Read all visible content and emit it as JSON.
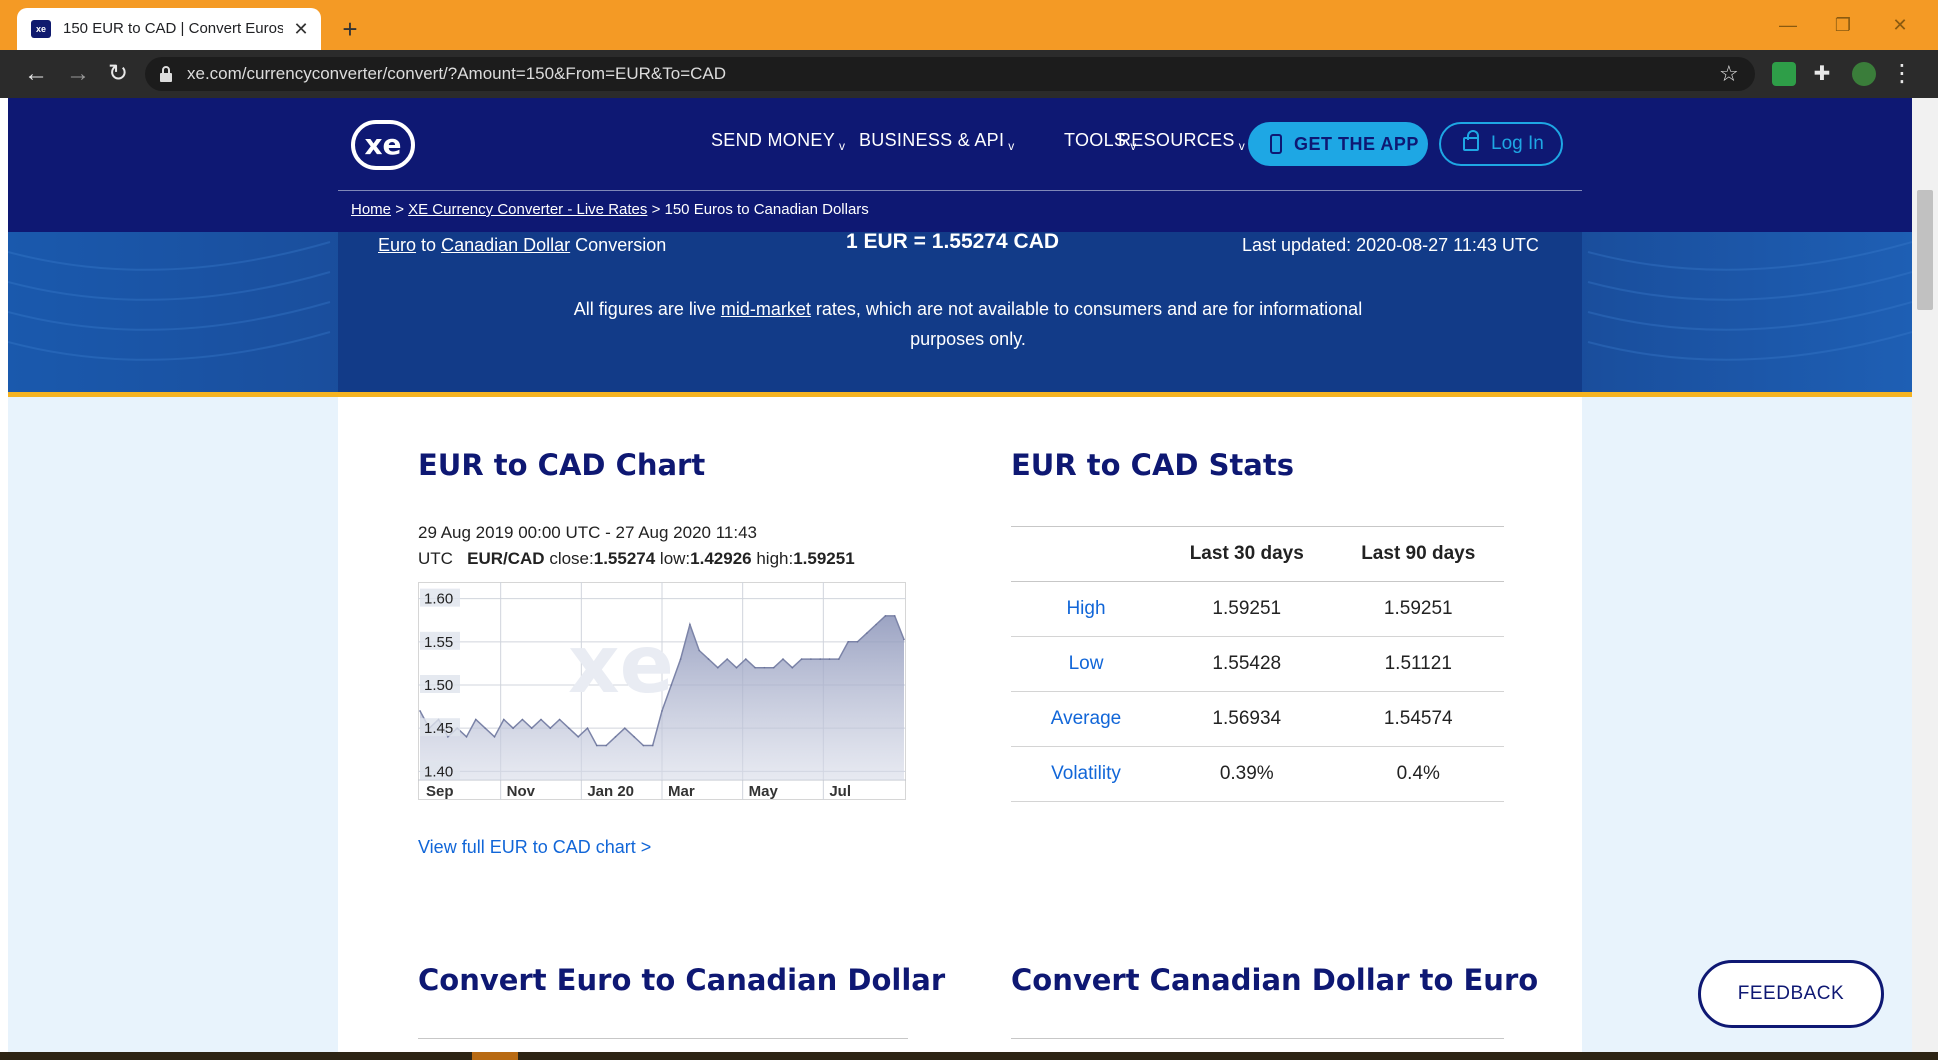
{
  "browser": {
    "tab_title": "150 EUR to CAD | Convert Euros t",
    "tab_favicon": "xe",
    "tab_close": "✕",
    "new_tab": "+",
    "url": "xe.com/currencyconverter/convert/?Amount=150&From=EUR&To=CAD",
    "controls": {
      "minimize": "—",
      "restore": "❐",
      "close": "✕"
    },
    "back": "←",
    "forward": "→",
    "reload": "↻",
    "menu": "⋮"
  },
  "site": {
    "logo_text": "xe",
    "nav": {
      "send_money": "SEND MONEY",
      "business_api": "BUSINESS & API",
      "tools": "TOOLS",
      "resources": "RESOURCES",
      "chevron": "v"
    },
    "get_app": "GET THE APP",
    "login": "Log In",
    "breadcrumb": {
      "home": "Home",
      "sep": ">",
      "converter": "XE Currency Converter - Live Rates",
      "current": "150 Euros to Canadian Dollars"
    }
  },
  "hero": {
    "from_currency": "Euro",
    "to_word": "to",
    "to_currency": "Canadian Dollar",
    "conversion_word": "Conversion",
    "rate": "1 EUR = 1.55274 CAD",
    "last_updated": "Last updated: 2020-08-27 11:43 UTC",
    "note_prefix": "All figures are live",
    "note_link": "mid-market",
    "note_suffix": "rates, which are not available to consumers and are for informational purposes only."
  },
  "chart_section": {
    "heading": "EUR to CAD Chart",
    "range": "29 Aug 2019 00:00 UTC - 27 Aug 2020 11:43",
    "utc": "UTC",
    "pair": "EUR/CAD",
    "close_label": "close:",
    "close_value": "1.55274",
    "low_label": "low:",
    "low_value": "1.42926",
    "high_label": "high:",
    "high_value": "1.59251",
    "watermark": "xe",
    "link": "View full EUR to CAD chart >"
  },
  "chart_data": {
    "type": "area",
    "title": "",
    "xlabel": "",
    "ylabel": "",
    "ylim": [
      1.39,
      1.61
    ],
    "yticks": [
      "1.60",
      "1.55",
      "1.50",
      "1.45",
      "1.40"
    ],
    "xticks": [
      "Sep",
      "Nov",
      "Jan 20",
      "Mar",
      "May",
      "Jul"
    ],
    "x": [
      "2019-08-29",
      "2019-09-05",
      "2019-09-12",
      "2019-09-19",
      "2019-09-26",
      "2019-10-03",
      "2019-10-10",
      "2019-10-17",
      "2019-10-24",
      "2019-10-31",
      "2019-11-07",
      "2019-11-14",
      "2019-11-21",
      "2019-11-28",
      "2019-12-05",
      "2019-12-12",
      "2019-12-19",
      "2019-12-26",
      "2020-01-02",
      "2020-01-09",
      "2020-01-16",
      "2020-01-23",
      "2020-01-30",
      "2020-02-06",
      "2020-02-13",
      "2020-02-20",
      "2020-02-27",
      "2020-03-05",
      "2020-03-12",
      "2020-03-19",
      "2020-03-26",
      "2020-04-02",
      "2020-04-09",
      "2020-04-16",
      "2020-04-23",
      "2020-04-30",
      "2020-05-07",
      "2020-05-14",
      "2020-05-21",
      "2020-05-28",
      "2020-06-04",
      "2020-06-11",
      "2020-06-18",
      "2020-06-25",
      "2020-07-02",
      "2020-07-09",
      "2020-07-16",
      "2020-07-23",
      "2020-07-30",
      "2020-08-06",
      "2020-08-13",
      "2020-08-20",
      "2020-08-27"
    ],
    "series": [
      {
        "values": [
          1.47,
          1.45,
          1.46,
          1.44,
          1.45,
          1.44,
          1.46,
          1.45,
          1.44,
          1.46,
          1.45,
          1.46,
          1.45,
          1.46,
          1.45,
          1.46,
          1.45,
          1.44,
          1.45,
          1.43,
          1.43,
          1.44,
          1.45,
          1.44,
          1.43,
          1.43,
          1.47,
          1.5,
          1.53,
          1.57,
          1.54,
          1.53,
          1.52,
          1.53,
          1.52,
          1.53,
          1.52,
          1.52,
          1.52,
          1.53,
          1.52,
          1.53,
          1.53,
          1.53,
          1.53,
          1.53,
          1.55,
          1.55,
          1.56,
          1.57,
          1.58,
          1.58,
          1.55274
        ]
      }
    ]
  },
  "stats_section": {
    "heading": "EUR to CAD Stats",
    "columns": [
      "",
      "Last 30 days",
      "Last 90 days"
    ],
    "rows": [
      {
        "label": "High",
        "d30": "1.59251",
        "d90": "1.59251"
      },
      {
        "label": "Low",
        "d30": "1.55428",
        "d90": "1.51121"
      },
      {
        "label": "Average",
        "d30": "1.56934",
        "d90": "1.54574"
      },
      {
        "label": "Volatility",
        "d30": "0.39%",
        "d90": "0.4%"
      }
    ]
  },
  "convert_section": {
    "left_heading": "Convert Euro to Canadian Dollar",
    "right_heading": "Convert Canadian Dollar to Euro"
  },
  "feedback": "FEEDBACK",
  "colors": {
    "titlebar": "#f49a25",
    "brand_navy": "#0e1873",
    "accent_blue": "#1ea7e4",
    "link_blue": "#1166d8",
    "gold": "#f5b321"
  },
  "icons": [
    "lock-icon",
    "star-icon",
    "extension-icon",
    "puzzle-icon",
    "profile-icon",
    "phone-icon",
    "padlock-icon"
  ]
}
